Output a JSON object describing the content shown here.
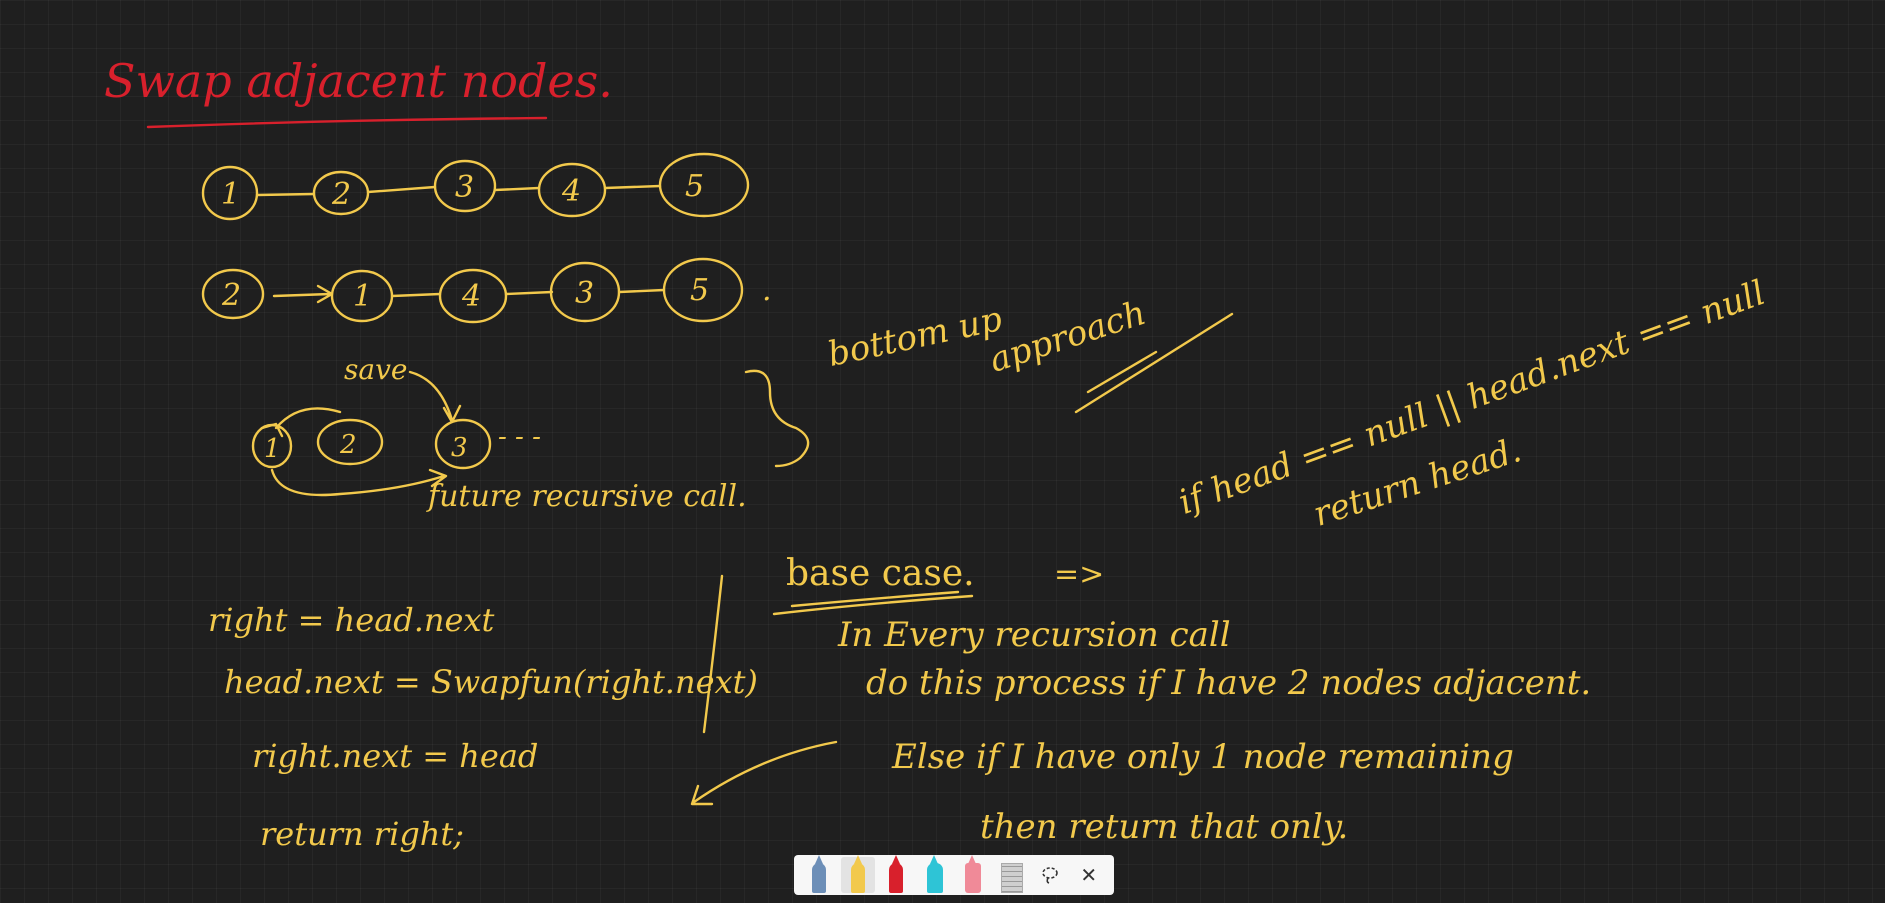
{
  "title": "Swap adjacent nodes.",
  "list_original": [
    "1",
    "2",
    "3",
    "4",
    "5"
  ],
  "list_swapped": [
    "2",
    "1",
    "4",
    "3",
    "5"
  ],
  "swapped_dot": ".",
  "diagram": {
    "save_label": "save",
    "nodes": [
      "1",
      "2",
      "3"
    ],
    "trailing": "- - -",
    "future_call_label": "future recursive call."
  },
  "approach": {
    "line1": "bottom up",
    "line2": "approach"
  },
  "condition": {
    "line1": "if head == null || head.next == null",
    "line2": "return head."
  },
  "code": {
    "line1": "right = head.next",
    "line2": "head.next = Swapfun(right.next)",
    "line3": "right.next = head",
    "line4": "return right;"
  },
  "base_case": {
    "heading": "base case.",
    "arrow": "=>",
    "line1": "In Every recursion call",
    "line2": "do this process if I have 2 nodes adjacent.",
    "line3": "Else if I have only 1 node remaining",
    "line4": "then return that only."
  },
  "toolbar": {
    "tools": [
      {
        "name": "ballpoint-pen-tool",
        "color": "#6d8fb8",
        "active": false
      },
      {
        "name": "pencil-tool",
        "color": "#f2c94c",
        "active": true
      },
      {
        "name": "red-pen-tool",
        "color": "#d8202c",
        "active": false
      },
      {
        "name": "highlighter-tool",
        "color": "#2ec4d6",
        "active": false
      },
      {
        "name": "eraser-tool",
        "color": "#f08a98",
        "active": false
      }
    ],
    "icons": [
      "ruler-icon",
      "lasso-select-icon",
      "close-icon"
    ]
  }
}
